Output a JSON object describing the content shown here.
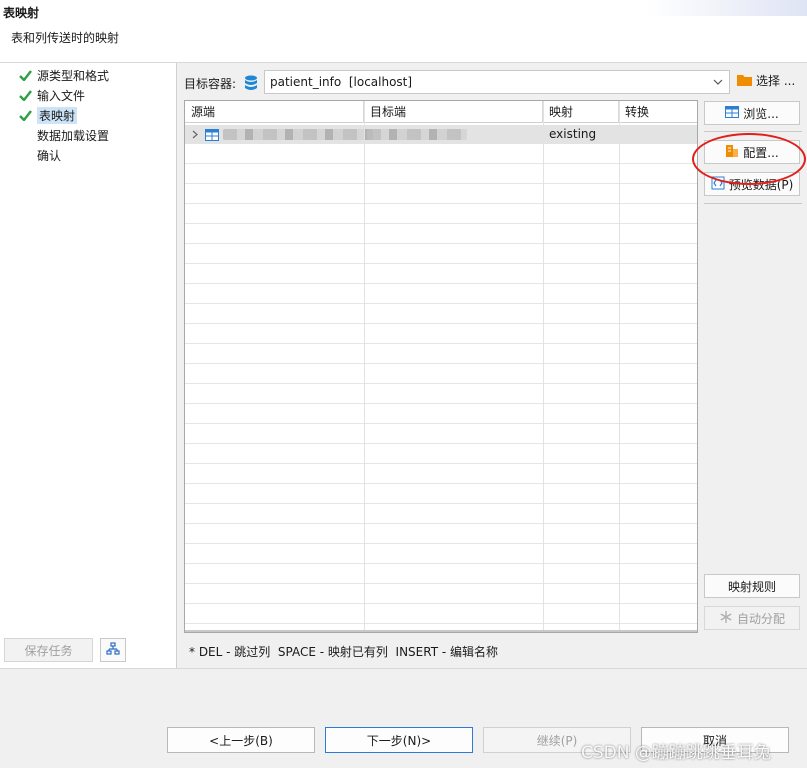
{
  "header": {
    "title": "表映射",
    "subtitle": "表和列传送时的映射"
  },
  "sidebar": {
    "steps": [
      {
        "label": "源类型和格式",
        "done": true
      },
      {
        "label": "输入文件",
        "done": true
      },
      {
        "label": "表映射",
        "done": true,
        "selected": true
      },
      {
        "label": "数据加载设置",
        "done": false
      },
      {
        "label": "确认",
        "done": false
      }
    ],
    "save_task": "保存任务"
  },
  "target": {
    "label": "目标容器:",
    "value": "patient_info  [localhost]",
    "choose": "选择 ..."
  },
  "grid": {
    "columns": [
      "源端",
      "目标端",
      "映射",
      "转换"
    ],
    "rows": [
      {
        "source": "",
        "target": "",
        "mapping": "existing",
        "transform": ""
      }
    ]
  },
  "side_buttons": {
    "browse": "浏览...",
    "configure": "配置...",
    "preview": "预览数据(P)",
    "mapping_rules": "映射规则",
    "auto_assign": "自动分配"
  },
  "hint": "* DEL - 跳过列  SPACE - 映射已有列  INSERT - 编辑名称",
  "footer": {
    "back": "<上一步(B)",
    "next": "下一步(N)>",
    "continue": "继续(P)",
    "cancel": "取消"
  },
  "watermark": "CSDN @蹦蹦跳跳垂耳兔",
  "colors": {
    "check": "#2ea043",
    "selection": "#cce4f7",
    "highlight_circle": "#e0201a",
    "db_icon": "#1e88d6",
    "folder_icon": "#f08c00"
  }
}
